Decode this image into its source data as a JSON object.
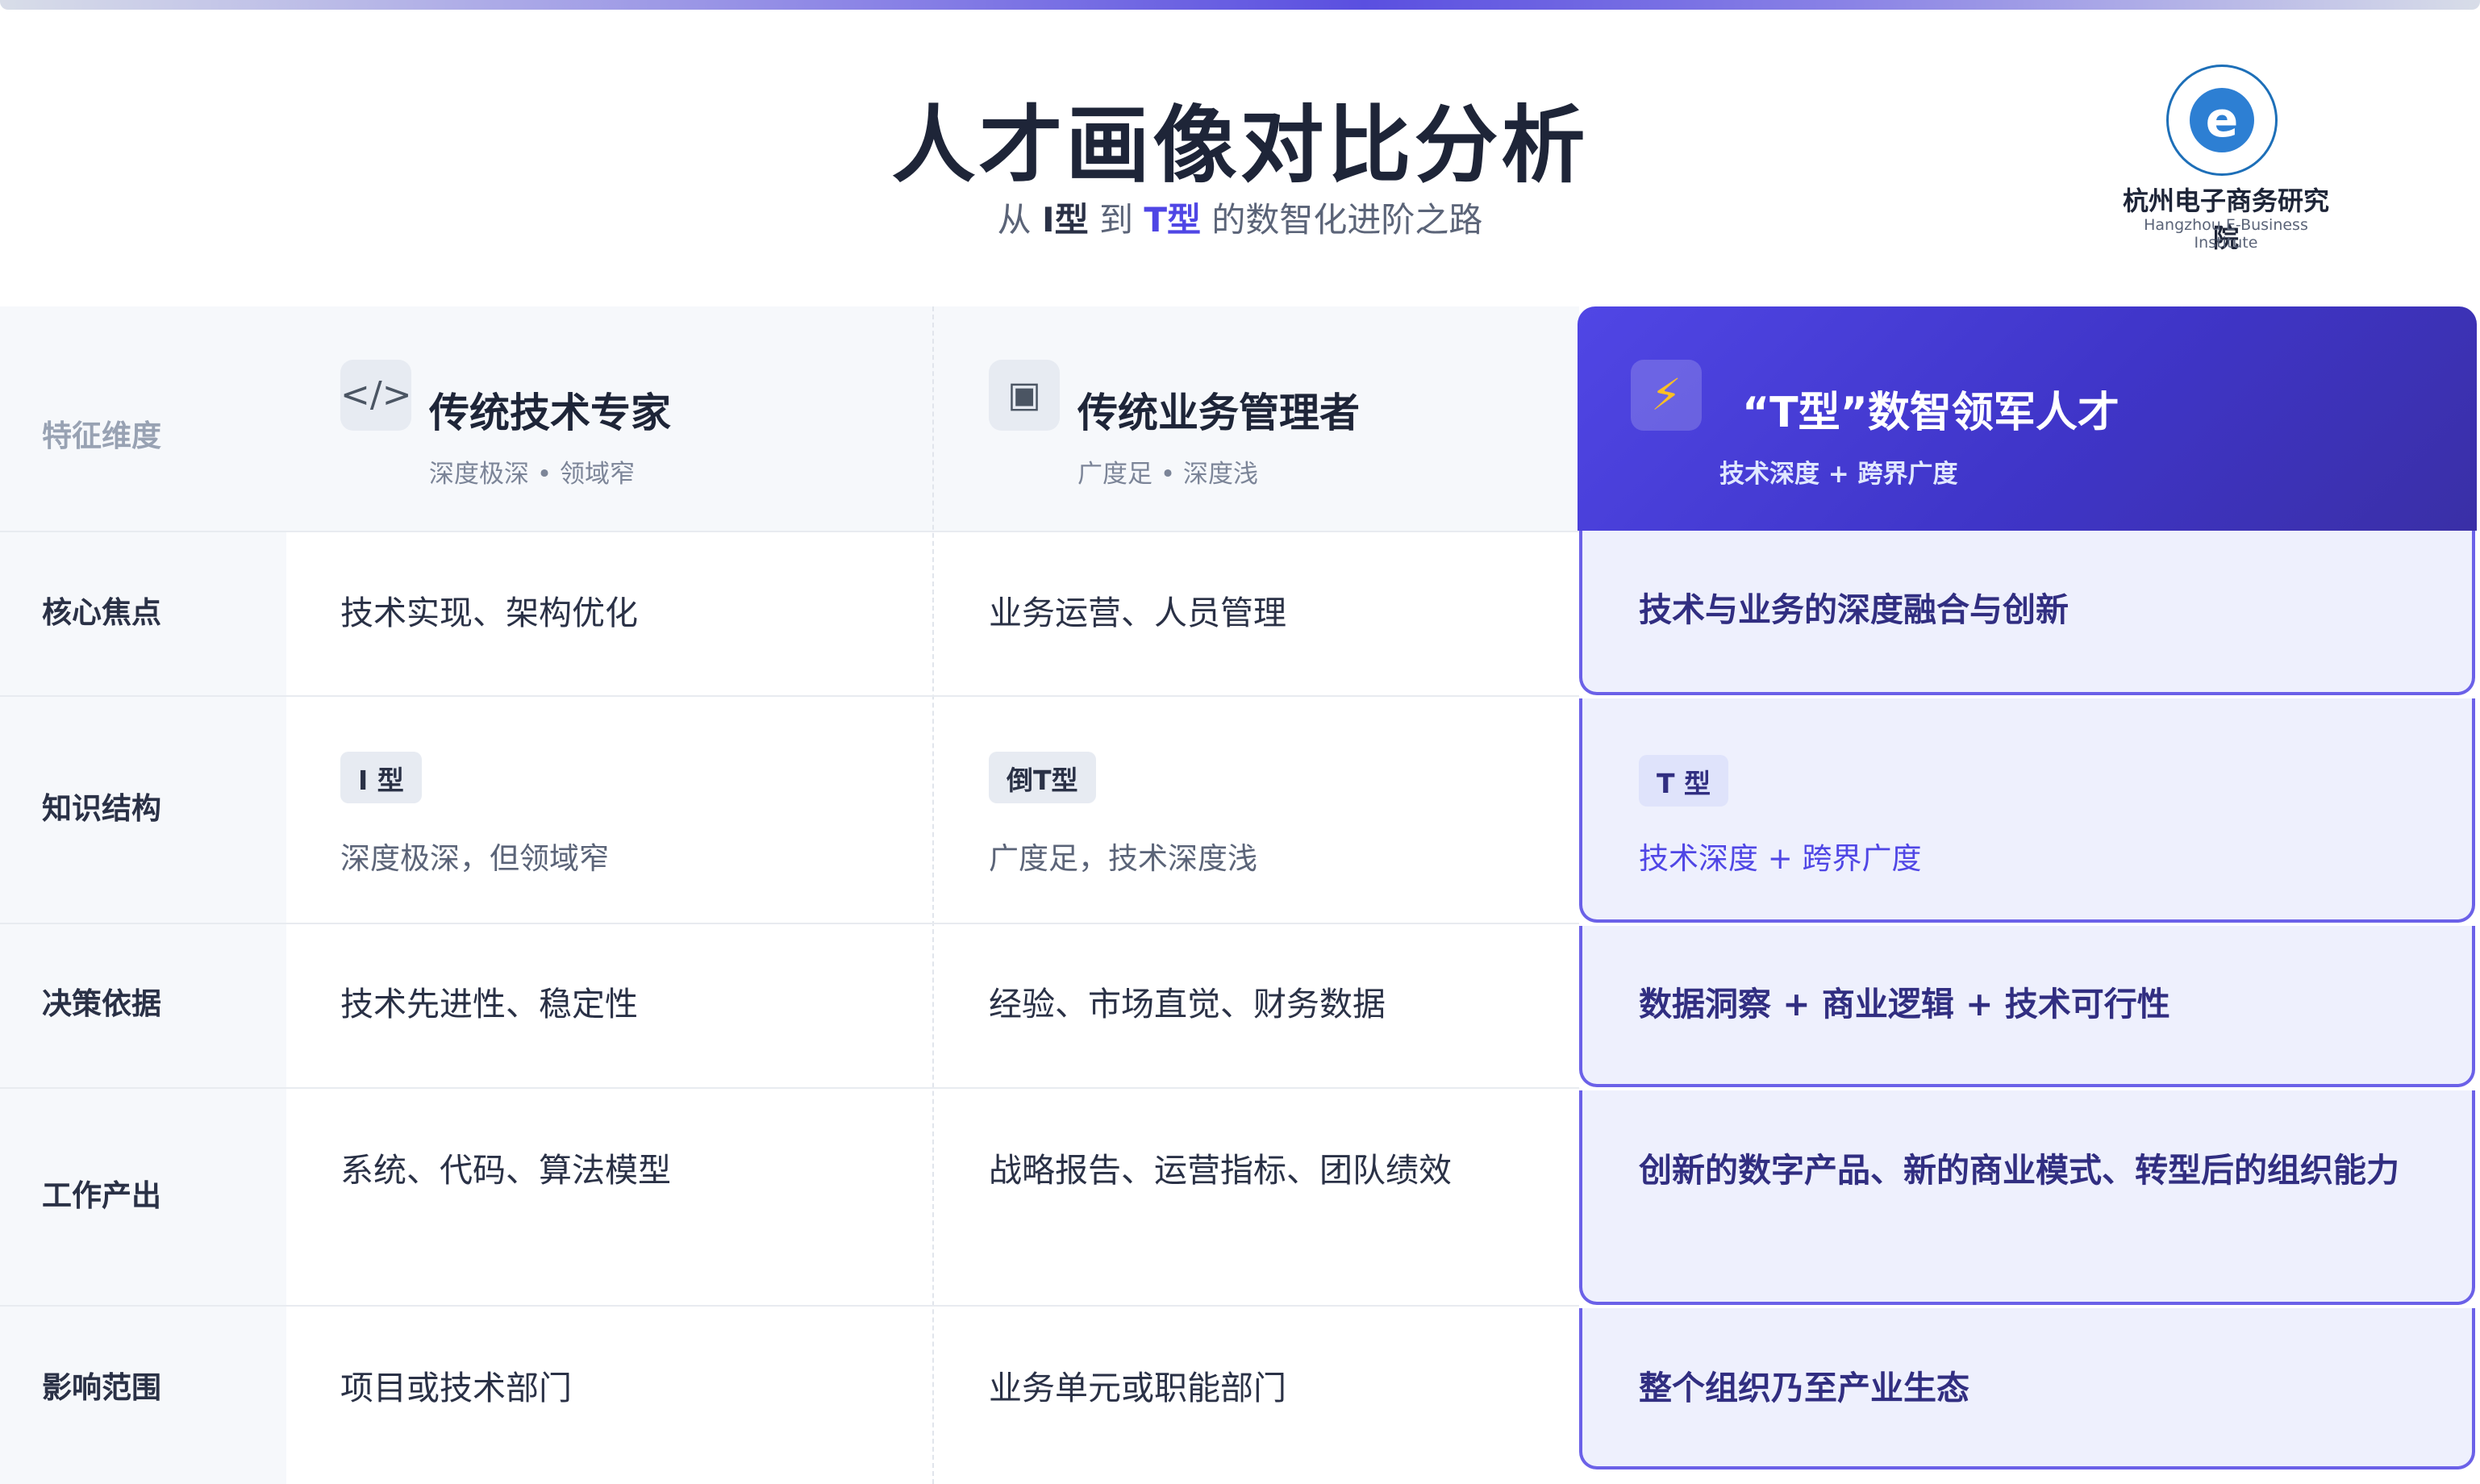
{
  "header": {
    "title": "人才画像对比分析",
    "subtitle": {
      "prefix": "从",
      "from": "I型",
      "to_word": "到",
      "to": "T型",
      "suffix": "的数智化进阶之路"
    }
  },
  "logo": {
    "mark": "e",
    "name_cn": "杭州电子商务研究院",
    "name_en": "Hangzhou E-Business Institute"
  },
  "table": {
    "dimension_label": "特征维度",
    "columns": [
      {
        "icon": "code-icon",
        "glyph": "</>",
        "title": "传统技术专家",
        "subtitle": "深度极深 • 领域窄"
      },
      {
        "icon": "briefcase-icon",
        "glyph": "▣",
        "title": "传统业务管理者",
        "subtitle": "广度足 • 深度浅"
      },
      {
        "icon": "lightning-icon",
        "glyph": "⚡",
        "title": "“T型”数智领军人才",
        "subtitle": "技术深度 + 跨界广度"
      }
    ],
    "rows": [
      {
        "label": "核心焦点",
        "cells": [
          "技术实现、架构优化",
          "业务运营、人员管理",
          "技术与业务的深度融合与创新"
        ]
      },
      {
        "label": "知识结构",
        "badges": [
          "I 型",
          "倒T型",
          "T 型"
        ],
        "cells": [
          "深度极深，但领域窄",
          "广度足，技术深度浅",
          "技术深度 + 跨界广度"
        ]
      },
      {
        "label": "决策依据",
        "cells": [
          "技术先进性、稳定性",
          "经验、市场直觉、财务数据",
          "数据洞察 + 商业逻辑 + 技术可行性"
        ]
      },
      {
        "label": "工作产出",
        "cells": [
          "系统、代码、算法模型",
          "战略报告、运营指标、团队绩效",
          "创新的数字产品、新的商业模式、转型后的组织能力"
        ]
      },
      {
        "label": "影响范围",
        "cells": [
          "项目或技术部门",
          "业务单元或职能部门",
          "整个组织乃至产业生态"
        ]
      }
    ]
  },
  "colors": {
    "accent": "#4f46e5",
    "accent_dark": "#3a2fa6",
    "highlight_bg": "#eef0fd",
    "text_dark": "#1e2538",
    "text_muted": "#5b6478"
  }
}
